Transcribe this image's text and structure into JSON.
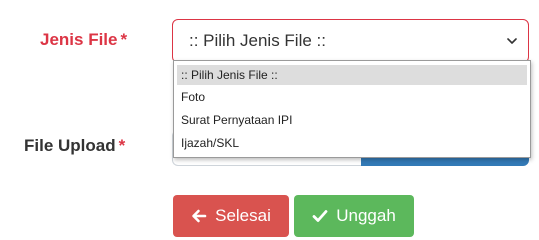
{
  "form": {
    "jenis_file": {
      "label": "Jenis File",
      "required_mark": "*",
      "selected_value": ":: Pilih Jenis File ::",
      "options": [
        ":: Pilih Jenis File ::",
        "Foto",
        "Surat Pernyataan IPI",
        "Ijazah/SKL"
      ]
    },
    "file_upload": {
      "label": "File Upload",
      "required_mark": "*"
    }
  },
  "buttons": {
    "selesai_label": "Selesai",
    "unggah_label": "Unggah"
  },
  "icons": {
    "selesai": "arrow-left-icon",
    "unggah": "check-icon",
    "select": "chevron-down-icon"
  },
  "colors": {
    "required": "#dc3545",
    "danger_button": "#d9534f",
    "success_button": "#5cb85c",
    "browse_button": "#337ab7",
    "option_highlight": "#dddddd"
  }
}
